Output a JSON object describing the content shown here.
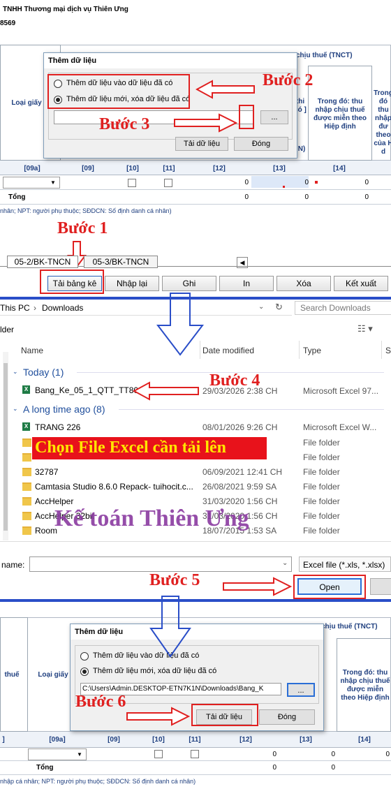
{
  "top": {
    "company": "TNHH Thương mại dịch vụ Thiên Ưng",
    "code": "8569",
    "header_tnct": "chịu thuế (TNCT)",
    "col_loai_giay": "Loại giấy",
    "col_trong_do1": "Trong đó: thu nhập chịu thuế được miễn theo Hiệp định",
    "col_trong_do2": "Trong đó thu nhập đư theo của H d",
    "col_partial": "thi có ]",
    "col_n": "N)",
    "col_codes": [
      "[09a]",
      "[09]",
      "[10]",
      "[11]",
      "[12]",
      "[13]",
      "[14]"
    ],
    "row_values": [
      "0",
      "0",
      "0"
    ],
    "total_label": "Tổng",
    "total_values": [
      "0",
      "0",
      "0"
    ],
    "footnote": "nhân; NPT: người phụ thuộc; SĐDCN: Số định danh cá nhân)"
  },
  "dialog1": {
    "title": "Thêm dữ liệu",
    "option1": "Thêm dữ liệu vào dữ liệu đã có",
    "option2": "Thêm dữ liệu mới, xóa dữ liệu đã có",
    "path_value": "",
    "browse_label": "...",
    "load_button": "Tải dữ liệu",
    "close_button": "Đóng"
  },
  "steps": {
    "s1": "Bước 1",
    "s2": "Bước 2",
    "s3": "Bước 3",
    "s4": "Bước 4",
    "s5": "Bước 5",
    "s6": "Bước 6"
  },
  "tabs": [
    "05-2/BK-TNCN",
    "05-3/BK-TNCN"
  ],
  "toolbar": [
    "Tải bảng kê",
    "Nhập lại",
    "Ghi",
    "In",
    "Xóa",
    "Kết xuất"
  ],
  "explorer": {
    "breadcrumb1": "This PC",
    "breadcrumb2": "Downloads",
    "search_placeholder": "Search Downloads",
    "folder_label": "lder",
    "col_name": "Name",
    "col_date": "Date modified",
    "col_type": "Type",
    "col_s": "S",
    "group_today": "Today (1)",
    "group_old": "A long time ago (8)",
    "files": [
      {
        "name": "Bang_Ke_05_1_QTT_TT80",
        "date": "29/03/2026 2:38 CH",
        "type": "Microsoft Excel 97..."
      },
      {
        "name": "TRANG 226",
        "date": "08/01/2026 9:26 CH",
        "type": "Microsoft Excel W..."
      },
      {
        "name": "",
        "date": "",
        "type": "File folder"
      },
      {
        "name": "",
        "date": "",
        "type": "File folder"
      },
      {
        "name": "32787",
        "date": "06/09/2021 12:41 CH",
        "type": "File folder"
      },
      {
        "name": "Camtasia Studio 8.6.0 Repack- tuihocit.c...",
        "date": "26/08/2021 9:59 SA",
        "type": "File folder"
      },
      {
        "name": "AccHelper",
        "date": "31/03/2020 1:56 CH",
        "type": "File folder"
      },
      {
        "name": "AccHelper 32bit",
        "date": "31/03/2020 1:56 CH",
        "type": "File folder"
      },
      {
        "name": "Room",
        "date": "18/07/2015 1:53 SA",
        "type": "File folder"
      }
    ],
    "banner": "Chọn File Excel cần tải lên",
    "watermark": "Kế toán Thiên Ưng",
    "filename_label": "name:",
    "filename_value": "",
    "filter": "Excel file (*.xls, *.xlsx)",
    "open_button": "Open"
  },
  "bottom": {
    "header_tnct": "chịu thuế (TNCT)",
    "col_thue": "thuế",
    "col_loai_giay": "Loại giấy",
    "col_trong_do1": "Trong đó: thu nhập chịu thuế được miễn theo Hiệp định",
    "col_codes": [
      "]",
      "[09a]",
      "[09]",
      "[10]",
      "[11]",
      "[12]",
      "[13]",
      "[14]"
    ],
    "row_values": [
      "0",
      "0",
      "0"
    ],
    "total_label": "Tổng",
    "total_values": [
      "0",
      "0"
    ],
    "footnote": "nhập cá nhân; NPT: người phụ thuộc; SĐDCN: Số định danh cá nhân)"
  },
  "dialog2": {
    "title": "Thêm dữ liệu",
    "option1": "Thêm dữ liệu vào dữ liệu đã có",
    "option2": "Thêm dữ liệu mới, xóa dữ liệu đã có",
    "path_value": "C:\\Users\\Admin.DESKTOP-ETN7K1N\\Downloads\\Bang_K",
    "browse_label": "...",
    "load_button": "Tải dữ liệu",
    "close_button": "Đóng"
  },
  "colors": {
    "step_red": "#e02020",
    "separator_blue": "#2a4ec8",
    "banner_red": "#e8121b",
    "banner_text": "#ffe600",
    "watermark": "#8a3aa0"
  }
}
